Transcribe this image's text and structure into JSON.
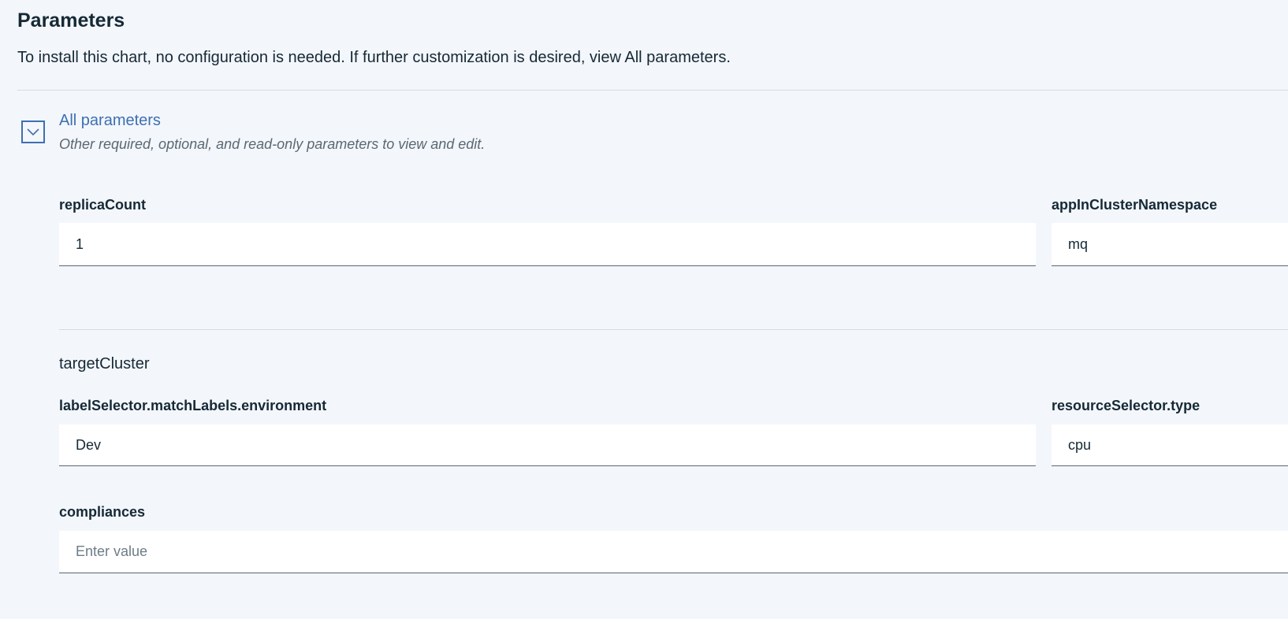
{
  "header": {
    "title": "Parameters",
    "description": "To install this chart, no configuration is needed. If further customization is desired, view All parameters."
  },
  "accordion": {
    "title": "All parameters",
    "subtitle": "Other required, optional, and read-only parameters to view and edit.",
    "icon": "chevron-down-icon",
    "expanded": true
  },
  "fields": {
    "replicaCount": {
      "label": "replicaCount",
      "value": "1"
    },
    "appInClusterNamespace": {
      "label": "appInClusterNamespace",
      "value": "mq"
    },
    "labelSelector": {
      "label": "labelSelector.matchLabels.environment",
      "value": "Dev"
    },
    "resourceSelector": {
      "label": "resourceSelector.type",
      "value": "cpu"
    },
    "compliances": {
      "label": "compliances",
      "value": "",
      "placeholder": "Enter value"
    }
  },
  "groups": {
    "targetCluster": {
      "title": "targetCluster"
    }
  },
  "colors": {
    "background": "#f3f6fb",
    "link": "#3d70b2",
    "text": "#152935",
    "divider": "#d6dbe2"
  }
}
